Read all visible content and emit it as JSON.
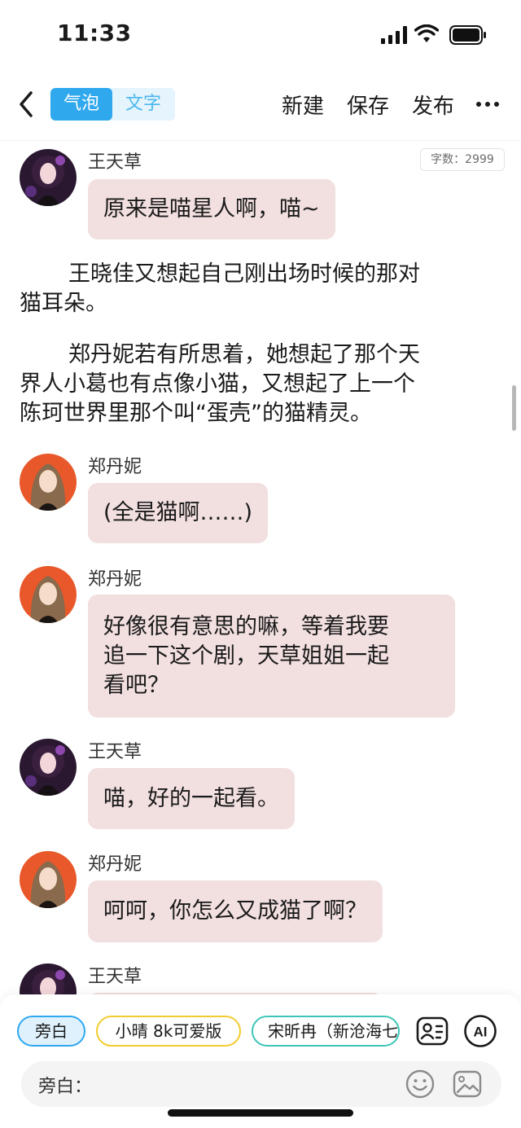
{
  "status_bar": {
    "time": "11:33"
  },
  "header": {
    "tabs": [
      {
        "label": "气泡",
        "active": true
      },
      {
        "label": "文字",
        "active": false
      }
    ],
    "actions": {
      "new": "新建",
      "save": "保存",
      "publish": "发布"
    }
  },
  "word_count": "字数：2999",
  "messages": [
    {
      "type": "bubble",
      "speaker": "王天草",
      "avatar": "purple-girl-avatar",
      "text": "原来是喵星人啊，喵~"
    },
    {
      "type": "narration",
      "text": "王晓佳又想起自己刚出场时候的那对猫耳朵。"
    },
    {
      "type": "narration",
      "text": "郑丹妮若有所思着，她想起了那个天界人小葛也有点像小猫，又想起了上一个陈珂世界里那个叫“蛋壳”的猫精灵。"
    },
    {
      "type": "bubble",
      "speaker": "郑丹妮",
      "avatar": "orange-girl-avatar",
      "text": "(全是猫啊……)"
    },
    {
      "type": "bubble",
      "speaker": "郑丹妮",
      "avatar": "orange-girl-avatar",
      "text_lines": [
        "好像很有意思的嘛，等着我要",
        "追一下这个剧，天草姐姐一起",
        "看吧？"
      ]
    },
    {
      "type": "bubble",
      "speaker": "王天草",
      "avatar": "purple-girl-avatar",
      "text": "喵，好的一起看。"
    },
    {
      "type": "bubble",
      "speaker": "郑丹妮",
      "avatar": "orange-girl-avatar",
      "text": "呵呵，你怎么又成猫了啊？"
    },
    {
      "type": "bubble",
      "speaker": "王天草",
      "avatar": "purple-girl-avatar",
      "text": ""
    }
  ],
  "narration_lines": {
    "n1": [
      "王晓佳又想起自己刚出场时候的那对",
      "猫耳朵。"
    ],
    "n2": [
      "郑丹妮若有所思着，她想起了那个天",
      "界人小葛也有点像小猫，又想起了上一个",
      "陈珂世界里那个叫“蛋壳”的猫精灵。"
    ]
  },
  "role_chips": [
    {
      "label": "旁白",
      "selected": true,
      "color": "#2fa8ee"
    },
    {
      "label": "小晴 8k可爱版",
      "selected": false,
      "color": "#f3cb2e"
    },
    {
      "label": "宋昕冉（新沧海七",
      "selected": false,
      "color": "#3cc6b8"
    }
  ],
  "composer": {
    "label": "旁白："
  },
  "colors": {
    "accent": "#2fa8ee",
    "bubble": "#f2dfe0",
    "tab_bg": "#e5f4fd"
  }
}
